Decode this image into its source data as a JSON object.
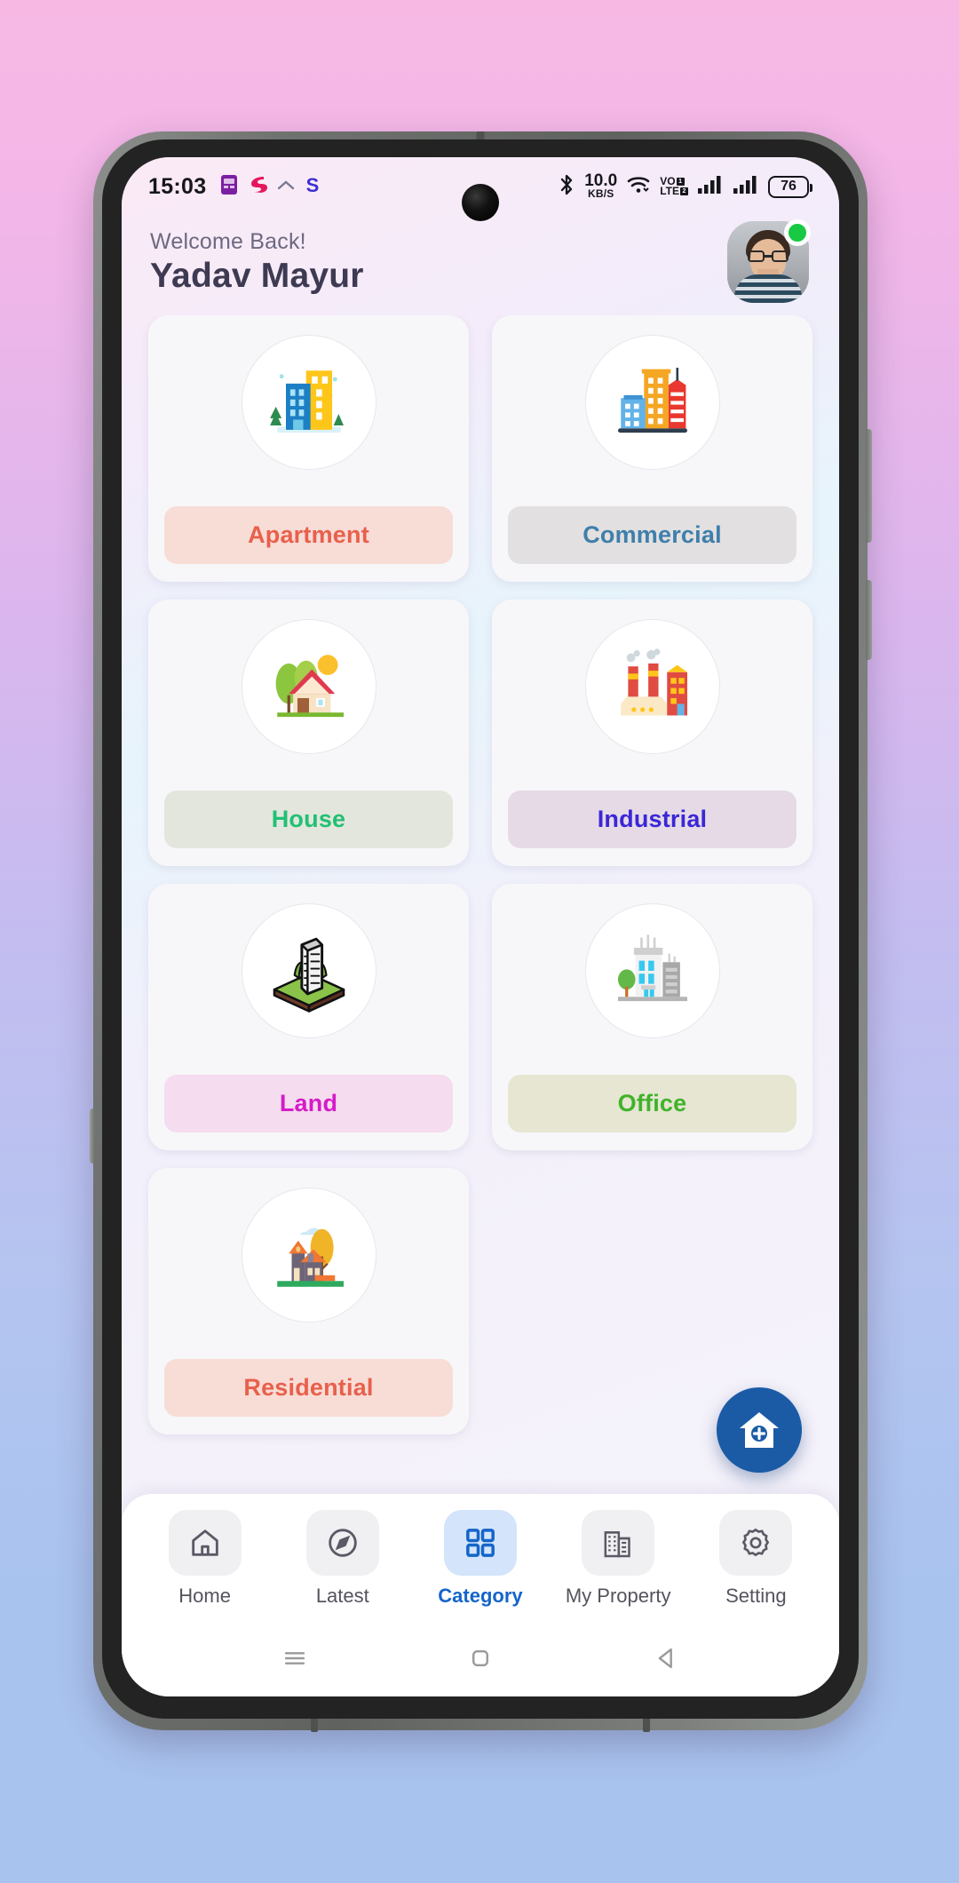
{
  "statusbar": {
    "time": "15:03",
    "left_icons": [
      "sim-card-icon",
      "app-s-red-icon",
      "chevron-up-icon",
      "app-s-blue-icon"
    ],
    "bluetooth": "bluetooth-icon",
    "network_speed_value": "10.0",
    "network_speed_unit": "KB/S",
    "wifi": "wifi-icon",
    "volte_top": "VoLTE",
    "volte_line1": "VO",
    "volte_line2": "LTE",
    "sim1_badge": "1",
    "sim2_badge": "2",
    "battery_percent": "76"
  },
  "header": {
    "greeting": "Welcome Back!",
    "username": "Yadav Mayur",
    "avatar_name": "user-avatar",
    "status": "online"
  },
  "categories": [
    {
      "label": "Apartment",
      "icon": "apartment-buildings-icon",
      "bar_bg": "#f8dcd6",
      "text_color": "#e8604c"
    },
    {
      "label": "Commercial",
      "icon": "commercial-buildings-icon",
      "bar_bg": "#e2e0e0",
      "text_color": "#3f7fab"
    },
    {
      "label": "House",
      "icon": "house-with-trees-icon",
      "bar_bg": "#e3e6dc",
      "text_color": "#21c074"
    },
    {
      "label": "Industrial",
      "icon": "factory-icon",
      "bar_bg": "#e6dae6",
      "text_color": "#3a27d6"
    },
    {
      "label": "Land",
      "icon": "land-plot-tower-icon",
      "bar_bg": "#f5dcee",
      "text_color": "#d41cc8"
    },
    {
      "label": "Office",
      "icon": "office-building-icon",
      "bar_bg": "#e6e6d2",
      "text_color": "#3fb32a"
    },
    {
      "label": "Residential",
      "icon": "residential-house-icon",
      "bar_bg": "#f8dcd6",
      "text_color": "#e8604c"
    }
  ],
  "fab": {
    "name": "add-property-button",
    "icon": "house-plus-icon",
    "color": "#1b5ba6"
  },
  "bottom_nav": {
    "active": "Category",
    "items": [
      {
        "label": "Home",
        "icon": "home-icon"
      },
      {
        "label": "Latest",
        "icon": "compass-icon"
      },
      {
        "label": "Category",
        "icon": "grid-icon"
      },
      {
        "label": "My Property",
        "icon": "building-icon"
      },
      {
        "label": "Setting",
        "icon": "gear-icon"
      }
    ]
  },
  "android_nav": {
    "recents": "recents-menu-icon",
    "home": "home-square-icon",
    "back": "back-triangle-icon"
  }
}
